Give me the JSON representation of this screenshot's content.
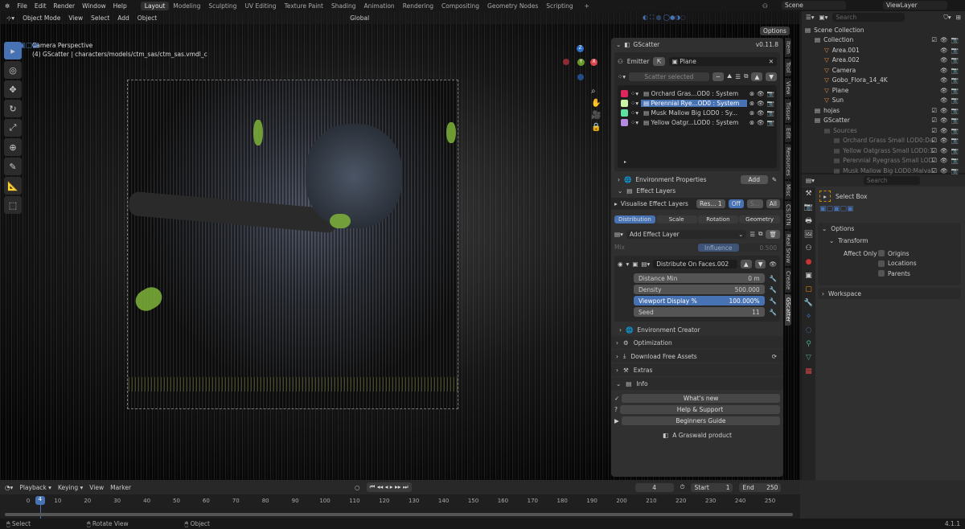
{
  "topbar": {
    "menus": [
      "File",
      "Edit",
      "Render",
      "Window",
      "Help"
    ],
    "workspaces": [
      "Layout",
      "Modeling",
      "Sculpting",
      "UV Editing",
      "Texture Paint",
      "Shading",
      "Animation",
      "Rendering",
      "Compositing",
      "Geometry Nodes",
      "Scripting"
    ],
    "active_workspace": "Layout",
    "add": "+",
    "scene": "Scene",
    "view_layer": "ViewLayer"
  },
  "viewport_header": {
    "mode": "Object Mode",
    "menus": [
      "View",
      "Select",
      "Add",
      "Object"
    ],
    "orientation": "Global",
    "options": "Options"
  },
  "viewport": {
    "view_name": "Camera Perspective",
    "object_info": "(4) GScatter | characters/models/ctm_sas/ctm_sas.vmdl_c",
    "gizmo_axes": [
      "X",
      "Y",
      "Z"
    ]
  },
  "sidebar_tabs": [
    "Item",
    "Tool",
    "View",
    "Tissue",
    "Edit",
    "Resources",
    "Misc",
    "CS:DTN",
    "Real Snow",
    "Create",
    "GScatter"
  ],
  "active_sidebar_tab": "GScatter",
  "gscatter": {
    "title": "GScatter",
    "version": "v0.11.8",
    "emitter_label": "Emitter",
    "emitter_value": "Plane",
    "scatter_selected": "Scatter selected",
    "systems": [
      {
        "name": "Orchard Gras...OD0 : System",
        "color": "#e0245e",
        "selected": false
      },
      {
        "name": "Perennial Rye...OD0 : System",
        "color": "#c8f5a8",
        "selected": true
      },
      {
        "name": "Musk Mallow Big LOD0 : Sy...",
        "color": "#5ee0a0",
        "selected": false
      },
      {
        "name": "Yellow Oatgr...LOD0 : System",
        "color": "#b48be0",
        "selected": false
      }
    ],
    "environment_properties": "Environment Properties",
    "add": "Add",
    "effect_layers": "Effect Layers",
    "visualise": "Visualise Effect Layers",
    "res": "Res...",
    "res_value": "1",
    "off": "Off",
    "s": "S...",
    "all": "All",
    "tabs": [
      "Distribution",
      "Scale",
      "Rotation",
      "Geometry"
    ],
    "active_tab": "Distribution",
    "add_effect_layer": "Add Effect Layer",
    "mix": "Mix",
    "influence": "Influence",
    "influence_value": "0.500",
    "influence_fraction": 0.5,
    "layer_name": "Distribute On Faces.002",
    "params": [
      {
        "label": "Distance Min",
        "value": "0 m"
      },
      {
        "label": "Density",
        "value": "500.000"
      },
      {
        "label": "Viewport Display %",
        "value": "100.000%",
        "highlight": true
      },
      {
        "label": "Seed",
        "value": "11"
      }
    ],
    "environment_creator": "Environment Creator",
    "sections": [
      "Optimization",
      "Download Free Assets",
      "Extras",
      "Info"
    ],
    "info_buttons": [
      "What's new",
      "Help & Support",
      "Beginners Guide"
    ],
    "footer": "A Graswald product"
  },
  "outliner": {
    "search_placeholder": "Search",
    "items": [
      {
        "name": "Scene Collection",
        "depth": 0,
        "dim": false
      },
      {
        "name": "Collection",
        "depth": 1,
        "dim": false
      },
      {
        "name": "Area.001",
        "depth": 2,
        "dim": false
      },
      {
        "name": "Area.002",
        "depth": 2,
        "dim": false
      },
      {
        "name": "Camera",
        "depth": 2,
        "dim": false
      },
      {
        "name": "Gobo_Flora_14_4K",
        "depth": 2,
        "dim": false
      },
      {
        "name": "Plane",
        "depth": 2,
        "dim": false
      },
      {
        "name": "Sun",
        "depth": 2,
        "dim": false
      },
      {
        "name": "hojas",
        "depth": 1,
        "dim": false
      },
      {
        "name": "GScatter",
        "depth": 1,
        "dim": false
      },
      {
        "name": "Sources",
        "depth": 2,
        "dim": true
      },
      {
        "name": "Orchard Grass Small LOD0:Da",
        "depth": 3,
        "dim": true
      },
      {
        "name": "Yellow Oatgrass Small LOD0:1",
        "depth": 3,
        "dim": true
      },
      {
        "name": "Perennial Ryegrass Small LOD",
        "depth": 3,
        "dim": true
      },
      {
        "name": "Musk Mallow Big LOD0:Malval",
        "depth": 3,
        "dim": true
      }
    ]
  },
  "properties": {
    "search_placeholder": "Search",
    "tool": "Select Box",
    "options": "Options",
    "transform": "Transform",
    "affect_only": "Affect Only",
    "checks": [
      "Origins",
      "Locations",
      "Parents"
    ],
    "workspace": "Workspace"
  },
  "timeline": {
    "menus": [
      "Playback",
      "Keying",
      "View",
      "Marker"
    ],
    "current_frame": "4",
    "start_label": "Start",
    "start": "1",
    "end_label": "End",
    "end": "250",
    "ticks": [
      "0",
      "10",
      "20",
      "30",
      "40",
      "50",
      "60",
      "70",
      "80",
      "90",
      "100",
      "110",
      "120",
      "130",
      "140",
      "150",
      "160",
      "170",
      "180",
      "190",
      "200",
      "210",
      "220",
      "230",
      "240",
      "250"
    ]
  },
  "status": {
    "items": [
      "Select",
      "Rotate View",
      "Object"
    ],
    "version": "4.1.1"
  }
}
